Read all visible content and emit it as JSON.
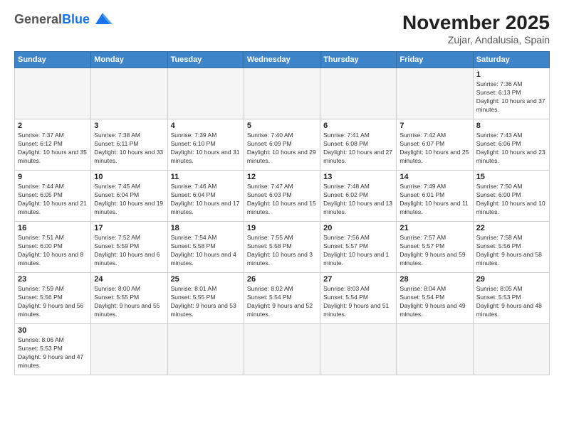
{
  "header": {
    "logo_general": "General",
    "logo_blue": "Blue",
    "month_title": "November 2025",
    "location": "Zujar, Andalusia, Spain"
  },
  "days_of_week": [
    "Sunday",
    "Monday",
    "Tuesday",
    "Wednesday",
    "Thursday",
    "Friday",
    "Saturday"
  ],
  "weeks": [
    [
      {
        "day": "",
        "empty": true
      },
      {
        "day": "",
        "empty": true
      },
      {
        "day": "",
        "empty": true
      },
      {
        "day": "",
        "empty": true
      },
      {
        "day": "",
        "empty": true
      },
      {
        "day": "",
        "empty": true
      },
      {
        "day": "1",
        "sunrise": "7:36 AM",
        "sunset": "6:13 PM",
        "daylight": "10 hours and 37 minutes."
      }
    ],
    [
      {
        "day": "2",
        "sunrise": "7:37 AM",
        "sunset": "6:12 PM",
        "daylight": "10 hours and 35 minutes."
      },
      {
        "day": "3",
        "sunrise": "7:38 AM",
        "sunset": "6:11 PM",
        "daylight": "10 hours and 33 minutes."
      },
      {
        "day": "4",
        "sunrise": "7:39 AM",
        "sunset": "6:10 PM",
        "daylight": "10 hours and 31 minutes."
      },
      {
        "day": "5",
        "sunrise": "7:40 AM",
        "sunset": "6:09 PM",
        "daylight": "10 hours and 29 minutes."
      },
      {
        "day": "6",
        "sunrise": "7:41 AM",
        "sunset": "6:08 PM",
        "daylight": "10 hours and 27 minutes."
      },
      {
        "day": "7",
        "sunrise": "7:42 AM",
        "sunset": "6:07 PM",
        "daylight": "10 hours and 25 minutes."
      },
      {
        "day": "8",
        "sunrise": "7:43 AM",
        "sunset": "6:06 PM",
        "daylight": "10 hours and 23 minutes."
      }
    ],
    [
      {
        "day": "9",
        "sunrise": "7:44 AM",
        "sunset": "6:05 PM",
        "daylight": "10 hours and 21 minutes."
      },
      {
        "day": "10",
        "sunrise": "7:45 AM",
        "sunset": "6:04 PM",
        "daylight": "10 hours and 19 minutes."
      },
      {
        "day": "11",
        "sunrise": "7:46 AM",
        "sunset": "6:04 PM",
        "daylight": "10 hours and 17 minutes."
      },
      {
        "day": "12",
        "sunrise": "7:47 AM",
        "sunset": "6:03 PM",
        "daylight": "10 hours and 15 minutes."
      },
      {
        "day": "13",
        "sunrise": "7:48 AM",
        "sunset": "6:02 PM",
        "daylight": "10 hours and 13 minutes."
      },
      {
        "day": "14",
        "sunrise": "7:49 AM",
        "sunset": "6:01 PM",
        "daylight": "10 hours and 11 minutes."
      },
      {
        "day": "15",
        "sunrise": "7:50 AM",
        "sunset": "6:00 PM",
        "daylight": "10 hours and 10 minutes."
      }
    ],
    [
      {
        "day": "16",
        "sunrise": "7:51 AM",
        "sunset": "6:00 PM",
        "daylight": "10 hours and 8 minutes."
      },
      {
        "day": "17",
        "sunrise": "7:52 AM",
        "sunset": "5:59 PM",
        "daylight": "10 hours and 6 minutes."
      },
      {
        "day": "18",
        "sunrise": "7:54 AM",
        "sunset": "5:58 PM",
        "daylight": "10 hours and 4 minutes."
      },
      {
        "day": "19",
        "sunrise": "7:55 AM",
        "sunset": "5:58 PM",
        "daylight": "10 hours and 3 minutes."
      },
      {
        "day": "20",
        "sunrise": "7:56 AM",
        "sunset": "5:57 PM",
        "daylight": "10 hours and 1 minute."
      },
      {
        "day": "21",
        "sunrise": "7:57 AM",
        "sunset": "5:57 PM",
        "daylight": "9 hours and 59 minutes."
      },
      {
        "day": "22",
        "sunrise": "7:58 AM",
        "sunset": "5:56 PM",
        "daylight": "9 hours and 58 minutes."
      }
    ],
    [
      {
        "day": "23",
        "sunrise": "7:59 AM",
        "sunset": "5:56 PM",
        "daylight": "9 hours and 56 minutes."
      },
      {
        "day": "24",
        "sunrise": "8:00 AM",
        "sunset": "5:55 PM",
        "daylight": "9 hours and 55 minutes."
      },
      {
        "day": "25",
        "sunrise": "8:01 AM",
        "sunset": "5:55 PM",
        "daylight": "9 hours and 53 minutes."
      },
      {
        "day": "26",
        "sunrise": "8:02 AM",
        "sunset": "5:54 PM",
        "daylight": "9 hours and 52 minutes."
      },
      {
        "day": "27",
        "sunrise": "8:03 AM",
        "sunset": "5:54 PM",
        "daylight": "9 hours and 51 minutes."
      },
      {
        "day": "28",
        "sunrise": "8:04 AM",
        "sunset": "5:54 PM",
        "daylight": "9 hours and 49 minutes."
      },
      {
        "day": "29",
        "sunrise": "8:05 AM",
        "sunset": "5:53 PM",
        "daylight": "9 hours and 48 minutes."
      }
    ],
    [
      {
        "day": "30",
        "sunrise": "8:06 AM",
        "sunset": "5:53 PM",
        "daylight": "9 hours and 47 minutes."
      },
      {
        "day": "",
        "empty": true
      },
      {
        "day": "",
        "empty": true
      },
      {
        "day": "",
        "empty": true
      },
      {
        "day": "",
        "empty": true
      },
      {
        "day": "",
        "empty": true
      },
      {
        "day": "",
        "empty": true
      }
    ]
  ]
}
